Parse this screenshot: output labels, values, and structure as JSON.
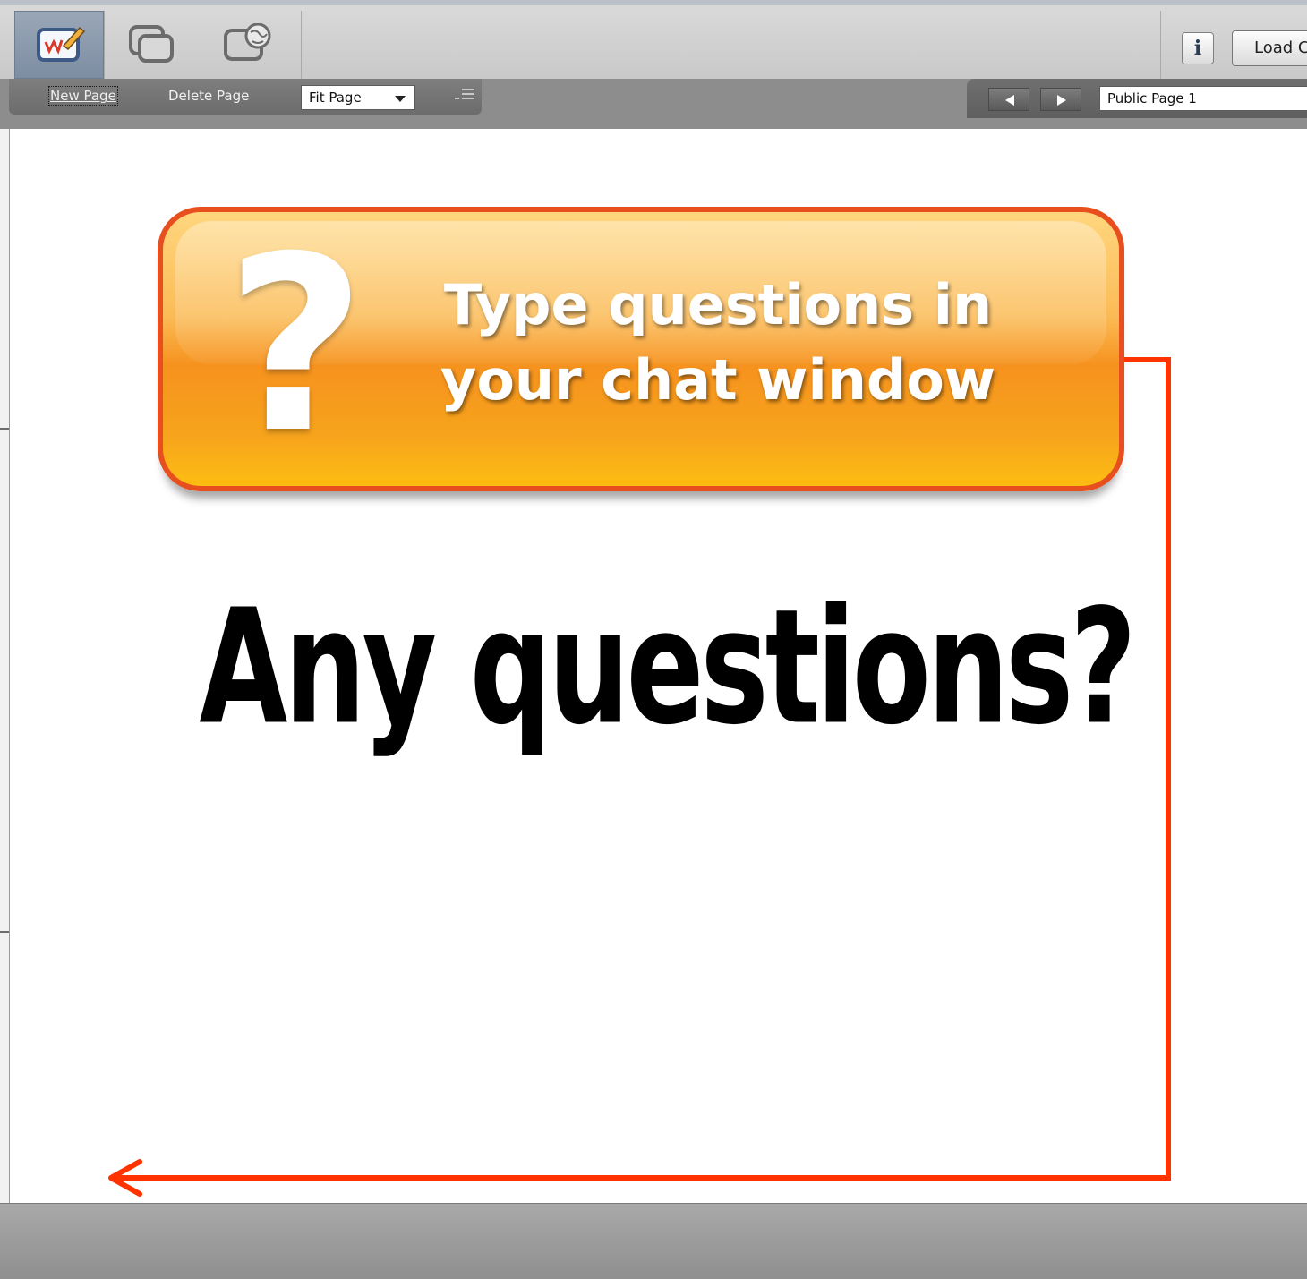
{
  "toolbar": {
    "tools": [
      {
        "name": "whiteboard-icon",
        "active": true
      },
      {
        "name": "screen-share-icon",
        "active": false
      },
      {
        "name": "web-browser-icon",
        "active": false
      }
    ],
    "info_label": "i",
    "load_button_label": "Load C"
  },
  "subbar": {
    "new_page_label": "New Page",
    "delete_page_label": "Delete Page",
    "zoom_value": "Fit Page",
    "page_value": "Public Page 1"
  },
  "slide": {
    "banner_text_line1": "Type questions in",
    "banner_text_line2": "your chat window",
    "question_mark": "?",
    "title": "Any questions?"
  },
  "colors": {
    "accent_orange": "#f6921e",
    "arrow_red": "#ff3300",
    "banner_border": "#e84f1f"
  }
}
